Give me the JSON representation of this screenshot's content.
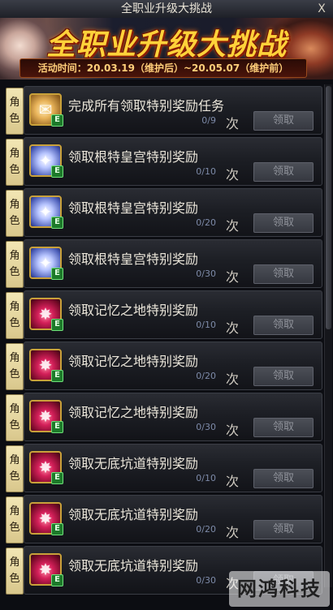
{
  "window": {
    "title": "全职业升级大挑战",
    "close_label": "X"
  },
  "banner": {
    "title": "全职业升级大挑战",
    "period": "活动时间：20.03.19（维护后）~20.05.07（维护前）"
  },
  "tasks": [
    {
      "role": [
        "角",
        "色"
      ],
      "icon": "scroll-icon",
      "grade": "E",
      "name": "完成所有领取特别奖励任务",
      "progress": "0/9",
      "unit": "次",
      "button": "领取"
    },
    {
      "role": [
        "角",
        "色"
      ],
      "icon": "ticket-icon",
      "grade": "E",
      "name": "领取根特皇宫特别奖励",
      "progress": "0/10",
      "unit": "次",
      "button": "领取"
    },
    {
      "role": [
        "角",
        "色"
      ],
      "icon": "ticket-icon",
      "grade": "E",
      "name": "领取根特皇宫特别奖励",
      "progress": "0/20",
      "unit": "次",
      "button": "领取"
    },
    {
      "role": [
        "角",
        "色"
      ],
      "icon": "ticket-icon",
      "grade": "E",
      "name": "领取根特皇宫特别奖励",
      "progress": "0/30",
      "unit": "次",
      "button": "领取"
    },
    {
      "role": [
        "角",
        "色"
      ],
      "icon": "crystal-icon",
      "grade": "E",
      "name": "领取记忆之地特别奖励",
      "progress": "0/10",
      "unit": "次",
      "button": "领取"
    },
    {
      "role": [
        "角",
        "色"
      ],
      "icon": "crystal-icon",
      "grade": "E",
      "name": "领取记忆之地特别奖励",
      "progress": "0/20",
      "unit": "次",
      "button": "领取"
    },
    {
      "role": [
        "角",
        "色"
      ],
      "icon": "crystal-icon",
      "grade": "E",
      "name": "领取记忆之地特别奖励",
      "progress": "0/30",
      "unit": "次",
      "button": "领取"
    },
    {
      "role": [
        "角",
        "色"
      ],
      "icon": "crystal-icon",
      "grade": "E",
      "name": "领取无底坑道特别奖励",
      "progress": "0/10",
      "unit": "次",
      "button": "领取"
    },
    {
      "role": [
        "角",
        "色"
      ],
      "icon": "crystal-icon",
      "grade": "E",
      "name": "领取无底坑道特别奖励",
      "progress": "0/20",
      "unit": "次",
      "button": "领取"
    },
    {
      "role": [
        "角",
        "色"
      ],
      "icon": "crystal-icon",
      "grade": "E",
      "name": "领取无底坑道特别奖励",
      "progress": "0/30",
      "unit": "次",
      "button": "领取"
    }
  ],
  "watermark": "网鸿科技"
}
